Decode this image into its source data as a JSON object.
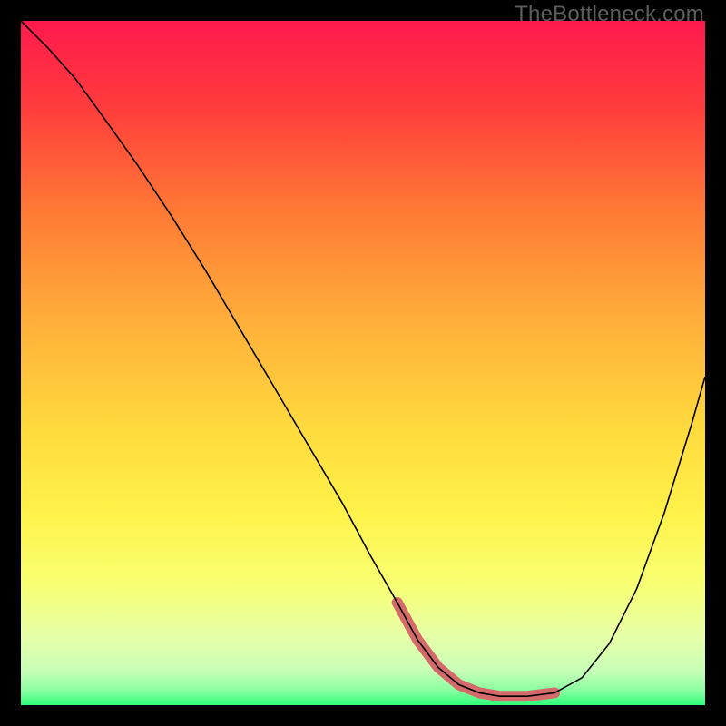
{
  "watermark": {
    "text": "TheBottleneck.com"
  },
  "chart_data": {
    "type": "line",
    "title": "",
    "xlabel": "",
    "ylabel": "",
    "xlim": [
      0,
      100
    ],
    "ylim": [
      0,
      100
    ],
    "gradient_stops": [
      {
        "pct": 0,
        "color": "#ff1a4d"
      },
      {
        "pct": 12,
        "color": "#ff3a3d"
      },
      {
        "pct": 28,
        "color": "#ff7a35"
      },
      {
        "pct": 45,
        "color": "#ffb23a"
      },
      {
        "pct": 60,
        "color": "#ffdb3d"
      },
      {
        "pct": 72,
        "color": "#fff24a"
      },
      {
        "pct": 82,
        "color": "#f8ff70"
      },
      {
        "pct": 90,
        "color": "#e6ffa8"
      },
      {
        "pct": 95,
        "color": "#c8ffb8"
      },
      {
        "pct": 98,
        "color": "#86ff9e"
      },
      {
        "pct": 100,
        "color": "#2cff7a"
      }
    ],
    "series": [
      {
        "name": "bottleneck-curve",
        "color": "#000000",
        "width": 1.6,
        "x": [
          0,
          4,
          8,
          12,
          17,
          22,
          27,
          32,
          37,
          42,
          47,
          51,
          55,
          58,
          61,
          64,
          67,
          70,
          74,
          78,
          82,
          86,
          90,
          94,
          98,
          100
        ],
        "y": [
          100,
          96,
          91.5,
          86,
          79,
          71.5,
          63.5,
          55,
          46.5,
          38,
          29.5,
          22,
          15,
          9.5,
          5.5,
          3,
          1.8,
          1.3,
          1.3,
          1.8,
          4,
          9,
          17,
          28,
          41,
          48
        ]
      }
    ],
    "highlight_segment": {
      "name": "optimal-region",
      "color": "#d46a6a",
      "width": 12,
      "cap": "round",
      "x": [
        55,
        58,
        61,
        64,
        67,
        70,
        74,
        78
      ],
      "y": [
        15,
        9.5,
        5.5,
        3,
        1.8,
        1.3,
        1.3,
        1.8
      ]
    }
  }
}
